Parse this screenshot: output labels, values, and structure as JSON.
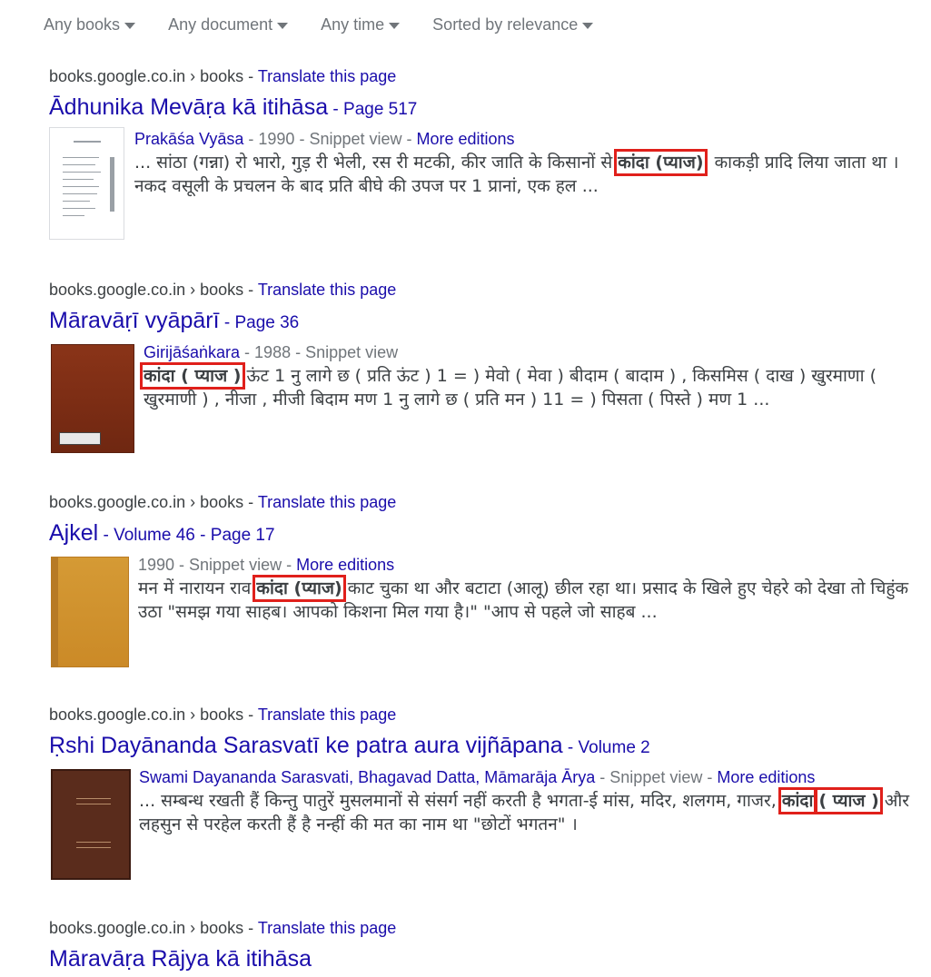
{
  "toolbar": {
    "filters": [
      {
        "label": "Any books"
      },
      {
        "label": "Any document"
      },
      {
        "label": "Any time"
      },
      {
        "label": "Sorted by relevance"
      }
    ]
  },
  "results": [
    {
      "cite": "books.google.co.in › books",
      "sep": " - ",
      "translate": "Translate this page",
      "title": "Ādhunika Mevāṛa kā itihāsa",
      "subtitle": "Page 517",
      "author": "Prakāśa Vyāsa",
      "meta_rest": " - 1990 - Snippet view - ",
      "more_editions": "More editions",
      "snippet_before": "... सांठा (गन्ना) रो भारो, गुड़ री भेली, रस री मटकी, कीर जाति के किसानों से ",
      "snippet_highlight": "कांदा (प्याज)",
      "snippet_after": ", काकड़ी प्रादि लिया जाता था । नकद वसूली के प्रचलन के बाद प्रति बीघे की उपज पर 1 प्रानां, एक हल ..."
    },
    {
      "cite": "books.google.co.in › books",
      "sep": " - ",
      "translate": "Translate this page",
      "title": "Māravāṛī vyāpārī",
      "subtitle": "Page 36",
      "author": "Girijāśaṅkara",
      "meta_rest": " - 1988 - Snippet view",
      "snippet_highlight": "कांदा ( प्याज )",
      "snippet_after": " ऊंट 1 नु लागे छ ( प्रति ऊंट ) 1 = ) मेवो ( मेवा ) बीदाम ( बादाम ) , किसमिस ( दाख ) खुरमाणा ( खुरमाणी ) , नीजा , मीजी बिदाम मण 1 नु लागे छ ( प्रति मन ) 11 = ) पिसता ( पिस्ते ) मण 1 ..."
    },
    {
      "cite": "books.google.co.in › books",
      "sep": " - ",
      "translate": "Translate this page",
      "title": "Ajkel",
      "subtitle": "Volume 46",
      "subtitle2": "Page 17",
      "meta_rest": "1990 - Snippet view - ",
      "more_editions": "More editions",
      "snippet_before": "मन में नारायन राव ",
      "snippet_highlight": "कांदा (प्याज)",
      "snippet_after": " काट चुका था और बटाटा (आलू) छील रहा था। प्रसाद के खिले हुए चेहरे को देखा तो चिहुंक उठा \"समझ गया साहब। आपको किशना मिल गया है।\" \"आप से पहले जो साहब ..."
    },
    {
      "cite": "books.google.co.in › books",
      "sep": " - ",
      "translate": "Translate this page",
      "title": "Ṛshi Dayānanda Sarasvatī ke patra aura vijñāpana",
      "subtitle": "Volume 2",
      "authors": [
        "Swami Dayananda Sarasvati",
        "Bhagavad Datta",
        "Māmarāja Ārya"
      ],
      "meta_rest": " - Snippet view - ",
      "more_editions": "More editions",
      "snippet_before": "... सम्बन्ध रखती हैं किन्तु पातुरें मुसलमानों से संसर्ग नहीं करती है भगता-ई मांस, मदिर, शलगम, गाजर, ",
      "snippet_highlight_a": "कांदा",
      "snippet_highlight_b": "( प्याज )",
      "snippet_after": " और लहसुन से परहेल करती हैं है नन्हीं की मत का नाम था \"छोटों भगतन\" ।"
    },
    {
      "cite": "books.google.co.in › books",
      "sep": " - ",
      "translate": "Translate this page",
      "title": "Māravāṛa Rājya kā itihāsa"
    }
  ]
}
